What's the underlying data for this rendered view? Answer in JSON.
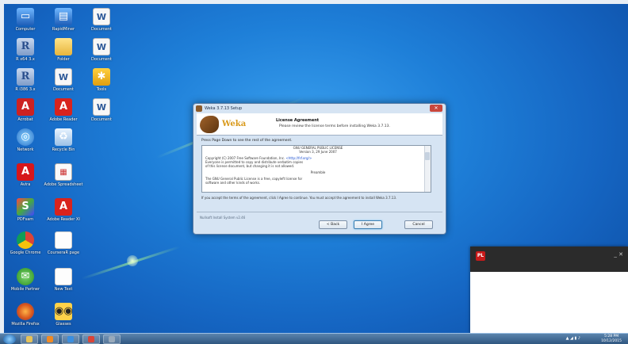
{
  "desktop": {
    "icons": [
      {
        "label": "Computer",
        "glyph": "▭",
        "cls": "g-computer"
      },
      {
        "label": "R x64 3.x",
        "glyph": "R",
        "cls": "g-r"
      },
      {
        "label": "R i386 3.x",
        "glyph": "R",
        "cls": "g-r"
      },
      {
        "label": "Acrobat",
        "glyph": "A",
        "cls": "g-acro"
      },
      {
        "label": "Network",
        "glyph": "◎",
        "cls": "g-net"
      },
      {
        "label": "Avira",
        "glyph": "A",
        "cls": "g-avira"
      },
      {
        "label": "PDFsam",
        "glyph": "S",
        "cls": "g-multi"
      },
      {
        "label": "Google Chrome",
        "glyph": "",
        "cls": "g-chrome"
      },
      {
        "label": "Mobile Partner",
        "glyph": "✉",
        "cls": "g-green"
      },
      {
        "label": "Mozilla Firefox",
        "glyph": "",
        "cls": "g-firefox"
      },
      {
        "label": "RapidMiner",
        "glyph": "▤",
        "cls": "g-computer"
      },
      {
        "label": "Folder",
        "glyph": "",
        "cls": "g-folder"
      },
      {
        "label": "Document",
        "glyph": "W",
        "cls": "g-doc"
      },
      {
        "label": "Adobe Reader",
        "glyph": "A",
        "cls": "g-pdf"
      },
      {
        "label": "Recycle Bin",
        "glyph": "♻",
        "cls": "g-recycle"
      },
      {
        "label": "Adobe Spreadsheet",
        "glyph": "▦",
        "cls": "g-sheet"
      },
      {
        "label": "Adobe Reader XI",
        "glyph": "A",
        "cls": "g-pdf"
      },
      {
        "label": "CourseraR page",
        "glyph": "",
        "cls": "g-blank"
      },
      {
        "label": "New Text",
        "glyph": "",
        "cls": "g-blank"
      },
      {
        "label": "Glasses",
        "glyph": "◉◉",
        "cls": "g-glasses"
      },
      {
        "label": "Document",
        "glyph": "W",
        "cls": "g-doc"
      },
      {
        "label": "Document",
        "glyph": "W",
        "cls": "g-doc"
      },
      {
        "label": "Tools",
        "glyph": "✱",
        "cls": "g-tools"
      },
      {
        "label": "Document",
        "glyph": "W",
        "cls": "g-doc"
      }
    ]
  },
  "dialog": {
    "title": "Weka 3.7.13 Setup",
    "close_glyph": "✕",
    "logo_text": "Weka",
    "header_title": "License Agreement",
    "header_subtitle": "Please review the license terms before installing Weka 3.7.13.",
    "instruction": "Press Page Down to see the rest of the agreement.",
    "license_lines": [
      "GNU GENERAL PUBLIC LICENSE",
      "Version 3, 29 June 2007",
      "Copyright (C) 2007 Free Software Foundation, Inc.",
      "Everyone is permitted to copy and distribute verbatim copies",
      "of this license document, but changing it is not allowed.",
      "Preamble",
      "The GNU General Public License is a free, copyleft license for",
      "software and other kinds of works."
    ],
    "license_link": "<http://fsf.org/>",
    "accept_text": "If you accept the terms of the agreement, click I Agree to continue. You must accept the agreement to install Weka 3.7.13.",
    "version_text": "Nullsoft Install System v2.46",
    "buttons": {
      "back": "< Back",
      "agree": "I Agree",
      "cancel": "Cancel"
    }
  },
  "toast": {
    "app_glyph": "PL",
    "controls": "_ ✕"
  },
  "taskbar": {
    "items": [
      {
        "name": "explorer",
        "color": "#e6c25a"
      },
      {
        "name": "media",
        "color": "#f08a24"
      },
      {
        "name": "ie",
        "color": "#3b8fe0"
      },
      {
        "name": "chrome",
        "color": "#db4437"
      },
      {
        "name": "app",
        "color": "#9ab"
      }
    ],
    "tray_icons": "▲ ◢ ▮ ♪",
    "time": "5:28 PM",
    "date": "10/12/2015"
  }
}
